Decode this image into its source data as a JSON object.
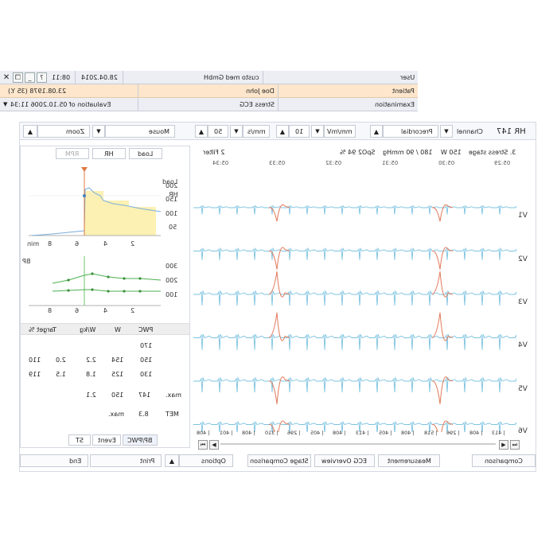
{
  "header": {
    "row1": {
      "user_label": "User",
      "company": "custo med GmbH",
      "date": "28.04.2014",
      "time": "08:11",
      "help": "?"
    },
    "row2": {
      "patient_label": "Patient",
      "name": "Doe John",
      "dob": "23.08.1978 (35 Y.)"
    },
    "row3": {
      "exam_label": "Examination",
      "type": "Stress ECG",
      "evaluation": "Evaluation of 05.10.2006 11:34"
    },
    "colors": {
      "row1_bg": "#eceef4",
      "row2_bg": "#fde6cc"
    }
  },
  "toolbar": {
    "hr": "HR 147",
    "channel_label": "Channel",
    "channel_value": "Precordial",
    "amp_unit": "mm/mV",
    "amp_value": "10",
    "speed_unit": "mm/s",
    "speed_value": "50",
    "mode": "Mouse",
    "zoom": "Zoom"
  },
  "left": {
    "tabs": {
      "load": "Load",
      "hr": "HR",
      "rpm": "RPM"
    },
    "legend": {
      "load": "Load",
      "hr": "HR",
      "bp": "BP"
    },
    "y_ticks_top": [
      "200",
      "150",
      "100",
      "50"
    ],
    "y_ticks_bp": [
      "300",
      "200",
      "100"
    ],
    "x_ticks": [
      "8",
      "6",
      "4",
      "2"
    ],
    "x_unit": "min",
    "pwc": {
      "headers": [
        "PWC",
        "W",
        "W/kg",
        "Target %"
      ],
      "rows": [
        [
          "170",
          "",
          "",
          "",
          ""
        ],
        [
          "150",
          "154",
          "2.2",
          "2.0",
          "110"
        ],
        [
          "130",
          "125",
          "1.8",
          "1.5",
          "119"
        ]
      ],
      "max_label": "max.",
      "max_values": [
        "147",
        "150",
        "2.1"
      ],
      "met_label": "MET",
      "met_value": "8.3",
      "met_max": "max."
    },
    "bottom_tabs": {
      "bp_pwc": "BP/PWC",
      "event": "Event",
      "st": "ST"
    }
  },
  "ecg": {
    "stage": "3. Stress stage",
    "watts": "150 W",
    "bp": "180 / 90 mmHg",
    "spo2": "SpO2 94 %",
    "filter": "2 Filter",
    "time_marks": [
      "05:29",
      "05:30",
      "05:31",
      "05:32",
      "05:33",
      "05:34"
    ],
    "leads": [
      "V1",
      "V2",
      "V3",
      "V4",
      "V5",
      "V6"
    ],
    "rr_intervals": [
      "413",
      "408",
      "296",
      "518",
      "408",
      "405",
      "413",
      "408",
      "405",
      "296",
      "310",
      "408",
      "401",
      "408"
    ],
    "colors": {
      "normal": "#7dc3e0",
      "ectopic": "#e27a5c"
    }
  },
  "bottom_buttons": {
    "comparison": "Comparison",
    "measurement": "Measurement",
    "ecg_overview": "ECG Overview",
    "stage_comparison": "Stage Comparison",
    "options": "Options",
    "print": "Print",
    "end": "End"
  }
}
